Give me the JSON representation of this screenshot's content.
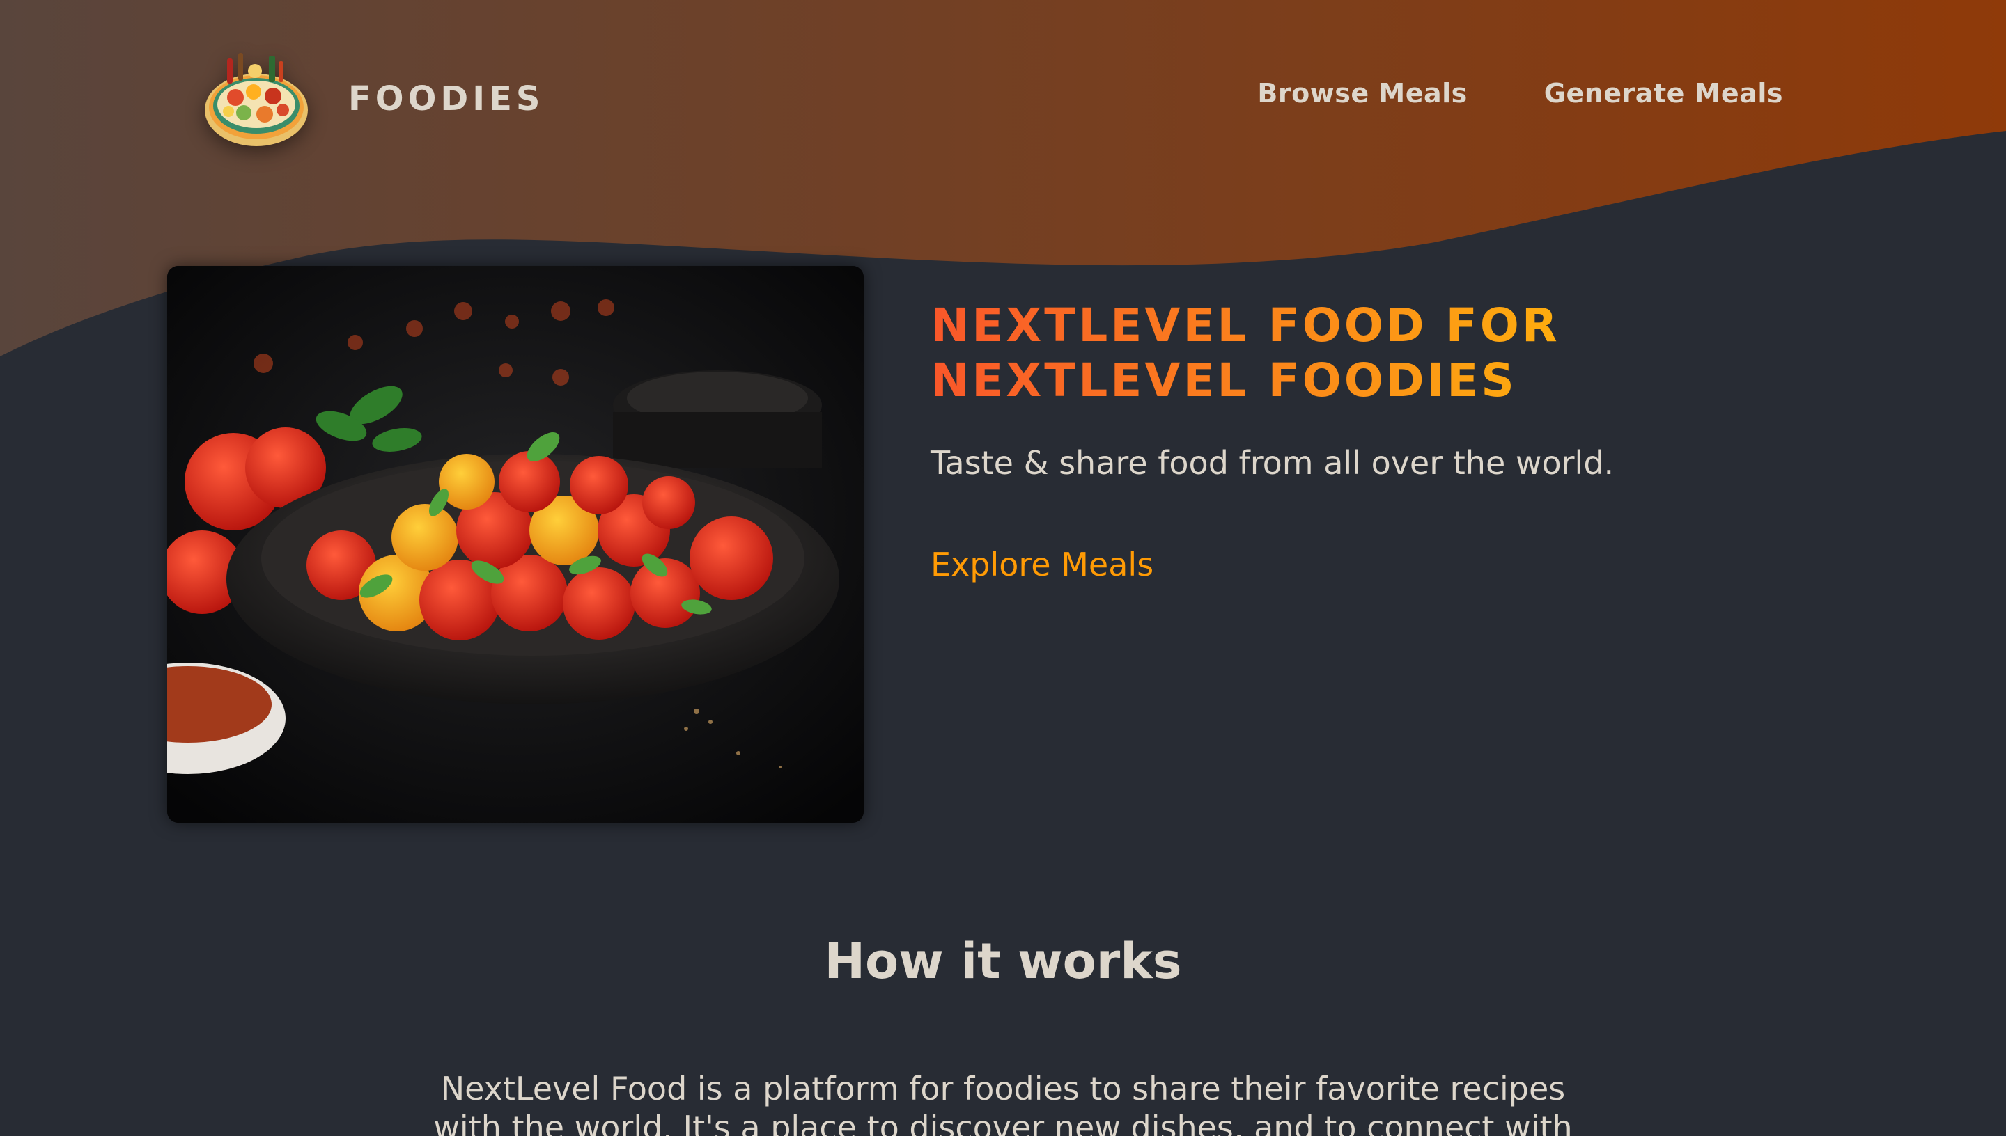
{
  "header": {
    "brand": "FOODIES",
    "nav": [
      {
        "label": "Browse Meals"
      },
      {
        "label": "Generate Meals"
      }
    ]
  },
  "hero": {
    "title_line_1": "NEXTLEVEL FOOD FOR",
    "title_line_2": "NEXTLEVEL FOODIES",
    "subtitle": "Taste & share food from all over the world.",
    "cta": "Explore Meals"
  },
  "how_it_works": {
    "title": "How it works",
    "body": "NextLevel Food is a platform for foodies to share their favorite recipes with the world. It's a place to discover new dishes, and to connect with"
  },
  "colors": {
    "background": "#282c34",
    "header_gradient_start": "#59453c",
    "header_gradient_end": "#8f3a09",
    "title_gradient_start": "#f9572a",
    "title_gradient_end": "#ffc905",
    "cta": "#ff9b05",
    "text": "#ddd6cb"
  },
  "icons": {
    "logo": "food-platter-icon",
    "hero_image": "tomato-salad-photo"
  }
}
